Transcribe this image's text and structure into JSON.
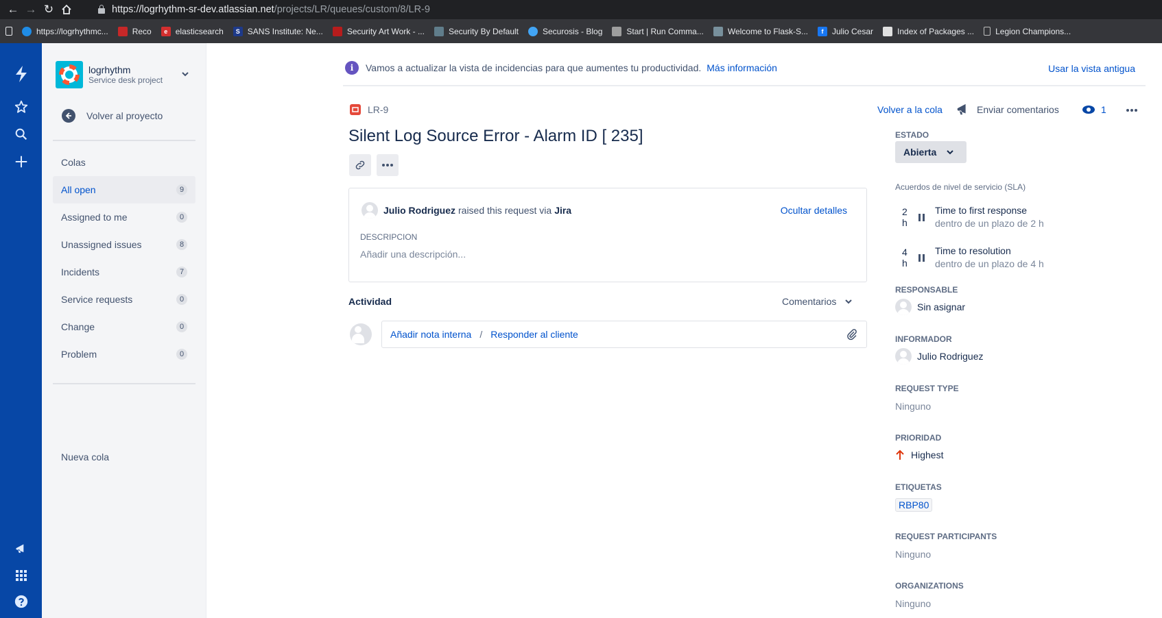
{
  "browser": {
    "url_host": "https://logrhythm-sr-dev.atlassian.net",
    "url_path": "/projects/LR/queues/custom/8/LR-9",
    "bookmarks": [
      {
        "label": "https://logrhythmc...",
        "color": "#1f8ce6"
      },
      {
        "label": "Reco",
        "color": "#c62828"
      },
      {
        "label": "elasticsearch",
        "color": "#d32f2f"
      },
      {
        "label": "SANS Institute: Ne...",
        "color": "#1e3a8a"
      },
      {
        "label": "Security Art Work - ...",
        "color": "#b71c1c"
      },
      {
        "label": "Security By Default",
        "color": "#607d8b"
      },
      {
        "label": "Securosis - Blog",
        "color": "#42a5f5"
      },
      {
        "label": "Start | Run Comma...",
        "color": "#9e9e9e"
      },
      {
        "label": "Welcome to Flask-S...",
        "color": "#78909c"
      },
      {
        "label": "Julio Cesar",
        "color": "#1877f2"
      },
      {
        "label": "Index of Packages ...",
        "color": "#e0e0e0"
      },
      {
        "label": "Legion Champions...",
        "color": "#bdbdbd"
      }
    ]
  },
  "project": {
    "name": "logrhythm",
    "type": "Service desk project",
    "back_label": "Volver al proyecto"
  },
  "queues": {
    "heading": "Colas",
    "items": [
      {
        "label": "All open",
        "count": "9"
      },
      {
        "label": "Assigned to me",
        "count": "0"
      },
      {
        "label": "Unassigned issues",
        "count": "8"
      },
      {
        "label": "Incidents",
        "count": "7"
      },
      {
        "label": "Service requests",
        "count": "0"
      },
      {
        "label": "Change",
        "count": "0"
      },
      {
        "label": "Problem",
        "count": "0"
      }
    ],
    "new_queue": "Nueva cola"
  },
  "banner": {
    "text": "Vamos a actualizar la vista de incidencias para que aumentes tu productividad.",
    "link": "Más información",
    "old_view": "Usar la vista antigua"
  },
  "issue": {
    "key": "LR-9",
    "title": "Silent Log Source Error - Alarm ID [ 235]",
    "reporter_name": "Julio Rodriguez",
    "raised_text": "raised this request via",
    "raised_via": "Jira",
    "hide_details": "Ocultar detalles",
    "description_label": "DESCRIPCION",
    "description_placeholder": "Añadir una descripción..."
  },
  "activity": {
    "heading": "Actividad",
    "filter": "Comentarios",
    "internal_note": "Añadir nota interna",
    "separator": "/",
    "reply_customer": "Responder al cliente"
  },
  "actions": {
    "back_to_queue": "Volver a la cola",
    "feedback": "Enviar comentarios",
    "watchers": "1"
  },
  "details": {
    "status_label": "ESTADO",
    "status_value": "Abierta",
    "sla_label": "Acuerdos de nivel de servicio (SLA)",
    "sla": [
      {
        "time": "2 h",
        "name": "Time to first response",
        "goal": "dentro de un plazo de 2 h"
      },
      {
        "time": "4 h",
        "name": "Time to resolution",
        "goal": "dentro de un plazo de 4 h"
      }
    ],
    "assignee_label": "RESPONSABLE",
    "assignee_value": "Sin asignar",
    "reporter_label": "INFORMADOR",
    "reporter_value": "Julio Rodriguez",
    "request_type_label": "REQUEST TYPE",
    "request_type_value": "Ninguno",
    "priority_label": "PRIORIDAD",
    "priority_value": "Highest",
    "labels_label": "ETIQUETAS",
    "labels_value": "RBP80",
    "participants_label": "REQUEST PARTICIPANTS",
    "participants_value": "Ninguno",
    "organizations_label": "ORGANIZATIONS",
    "organizations_value": "Ninguno"
  },
  "colors": {
    "global_nav": "#0747a6",
    "link": "#0052cc",
    "priority_highest": "#de350b",
    "info": "#6554c0"
  }
}
